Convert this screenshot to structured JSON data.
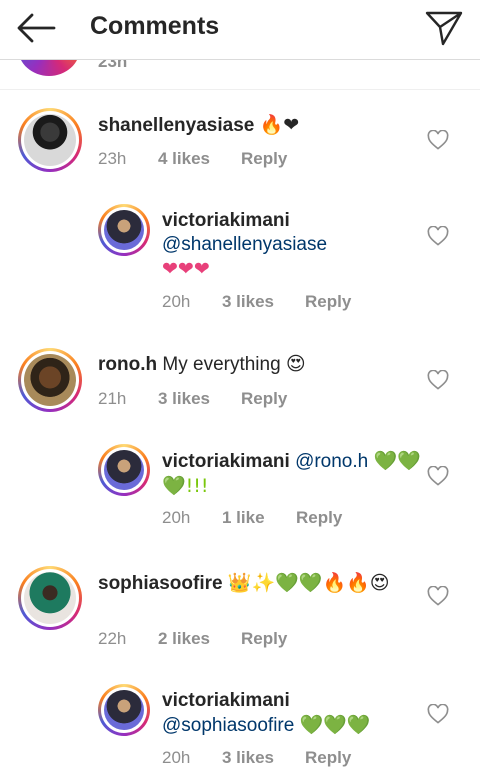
{
  "header": {
    "title": "Comments",
    "back_icon": "arrow-left-icon",
    "send_icon": "paper-plane-icon"
  },
  "cutoff": {
    "time": "23h"
  },
  "comments": [
    {
      "username": "shanellenyasiase",
      "text": "🔥❤",
      "time": "23h",
      "likes": "4 likes",
      "reply": "Reply"
    },
    {
      "username": "victoriakimani",
      "mention": "@shanellenyasiase",
      "text": "❤❤❤",
      "time": "20h",
      "likes": "3 likes",
      "reply": "Reply"
    },
    {
      "username": "rono.h",
      "text": "My everything 😍",
      "time": "21h",
      "likes": "3 likes",
      "reply": "Reply"
    },
    {
      "username": "victoriakimani",
      "mention": "@rono.h",
      "text": "💚💚💚!!!",
      "time": "20h",
      "likes": "1 like",
      "reply": "Reply"
    },
    {
      "username": "sophiasoofire",
      "text": "👑✨💚💚🔥🔥😍",
      "time": "22h",
      "likes": "2 likes",
      "reply": "Reply"
    },
    {
      "username": "victoriakimani",
      "mention": "@sophiasoofire",
      "text": "💚💚💚",
      "time": "20h",
      "likes": "3 likes",
      "reply": "Reply"
    }
  ],
  "colors": {
    "text": "#262626",
    "muted": "#8e8e8e",
    "mention": "#00376b",
    "pink_heart": "#e8407a",
    "green_heart": "#7ac70c"
  }
}
